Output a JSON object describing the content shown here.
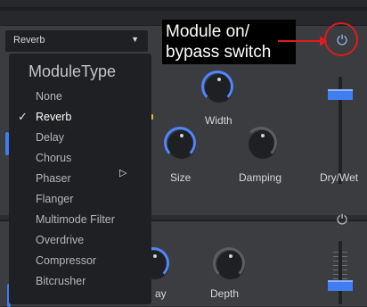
{
  "module1": {
    "type_selected": "Reverb",
    "power_icon": "power-icon",
    "power_state": "on",
    "labels": {
      "width": "Width",
      "size": "Size",
      "damping": "Damping",
      "drywet": "Dry/Wet"
    }
  },
  "dropdown_menu": {
    "title": "ModuleType",
    "items": [
      {
        "label": "None",
        "selected": false
      },
      {
        "label": "Reverb",
        "selected": true
      },
      {
        "label": "Delay",
        "selected": false
      },
      {
        "label": "Chorus",
        "selected": false
      },
      {
        "label": "Phaser",
        "selected": false
      },
      {
        "label": "Flanger",
        "selected": false
      },
      {
        "label": "Multimode Filter",
        "selected": false
      },
      {
        "label": "Overdrive",
        "selected": false
      },
      {
        "label": "Compressor",
        "selected": false
      },
      {
        "label": "Bitcrusher",
        "selected": false
      }
    ],
    "check_glyph": "✓",
    "cursor_icon": "mouse-pointer-icon"
  },
  "module2": {
    "power_state": "off",
    "labels": {
      "delay_partial": "ay",
      "depth": "Depth"
    }
  },
  "annotation": {
    "text_line1": "Module on/",
    "text_line2": "bypass switch",
    "color": "#e01b1b"
  },
  "colors": {
    "accent_blue": "#3f7df0",
    "panel_bg": "#3a3c3f",
    "menu_bg": "#1f2023"
  }
}
